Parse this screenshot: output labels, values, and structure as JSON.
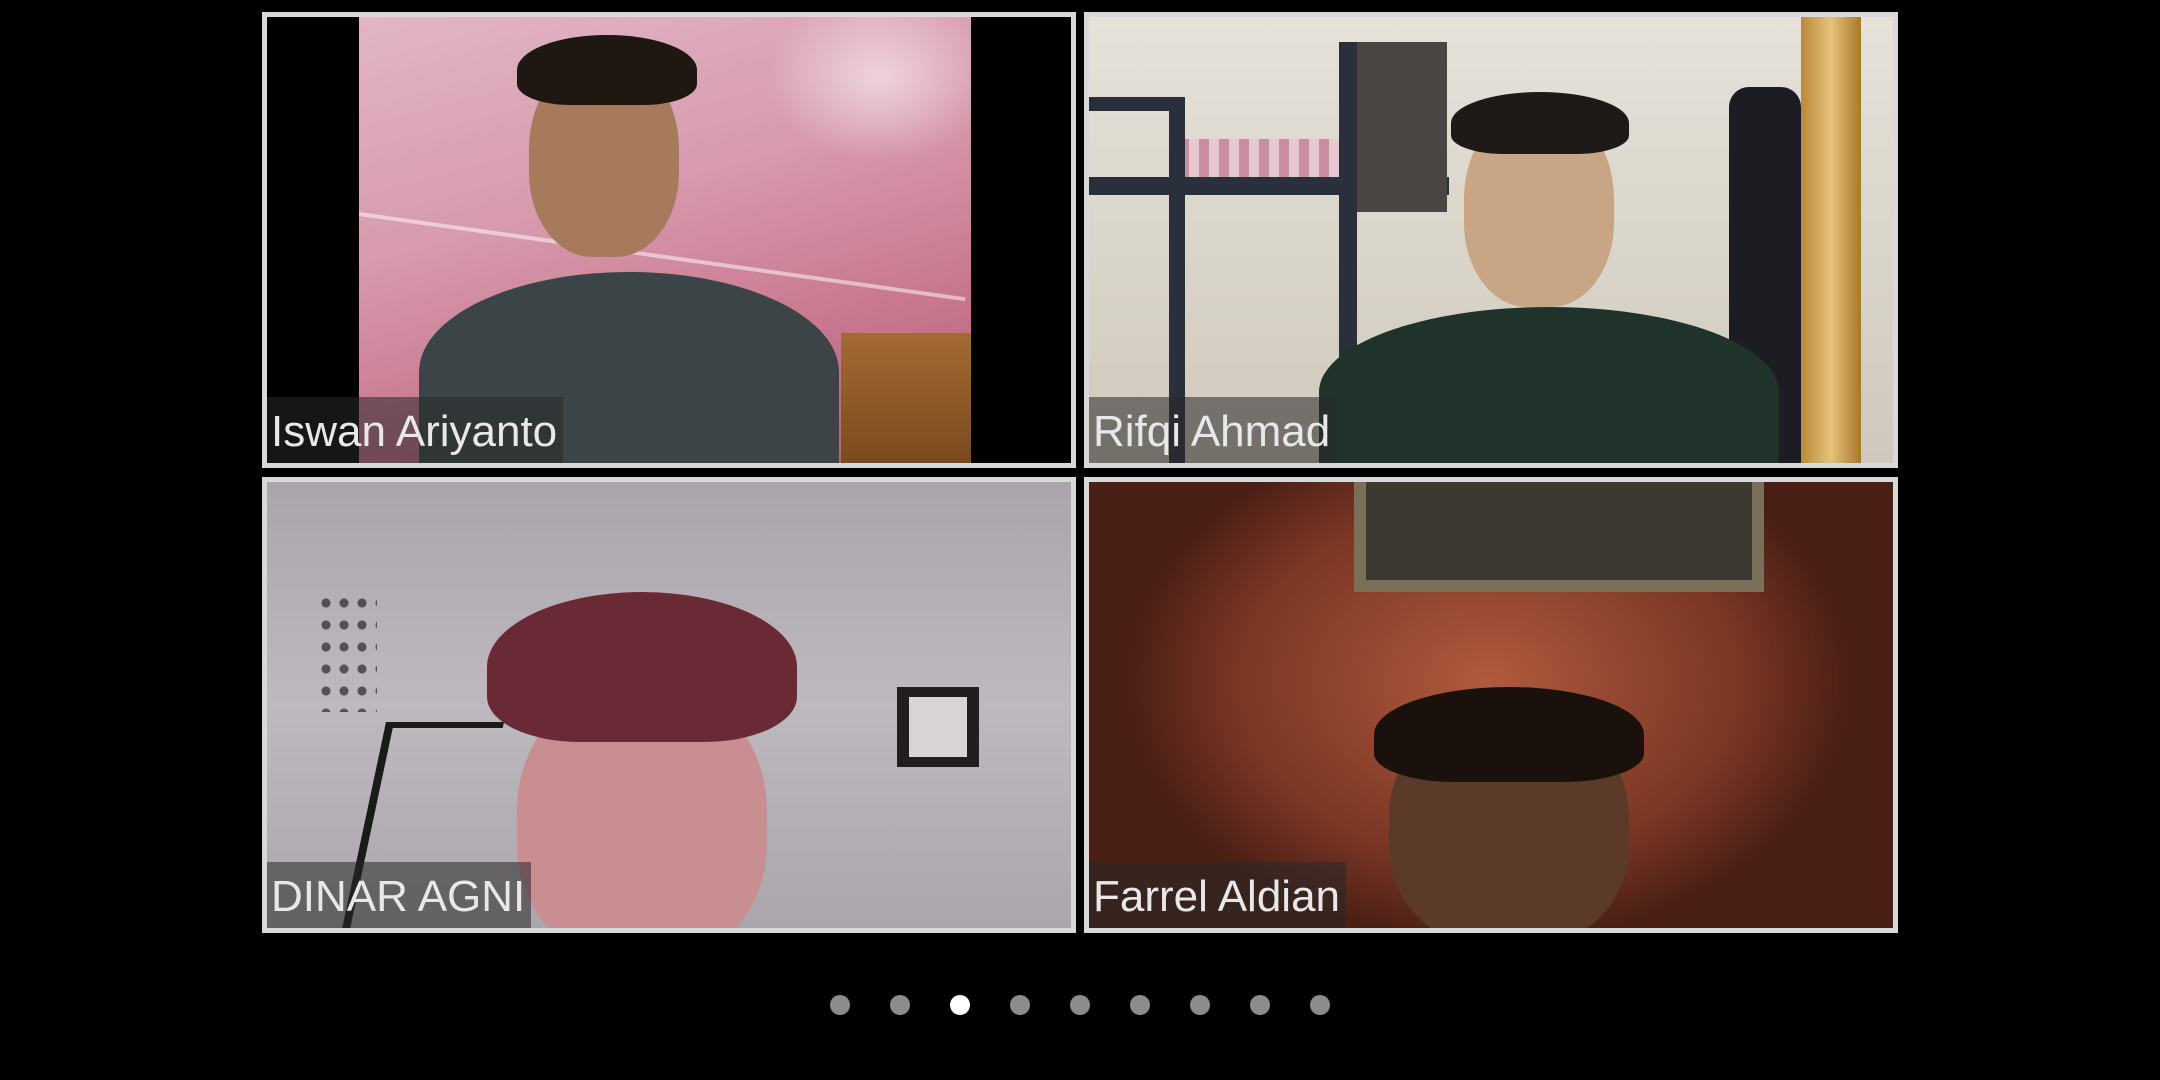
{
  "participants": [
    {
      "name": "Iswan Ariyanto"
    },
    {
      "name": "Rifqi Ahmad"
    },
    {
      "name": "DINAR AGNI"
    },
    {
      "name": "Farrel Aldian"
    }
  ],
  "pagination": {
    "total_pages": 9,
    "active_page": 3
  },
  "colors": {
    "background": "#000000",
    "tile_border": "#d9d9d9",
    "dot_inactive": "#8c8c8c",
    "dot_active": "#ffffff"
  }
}
